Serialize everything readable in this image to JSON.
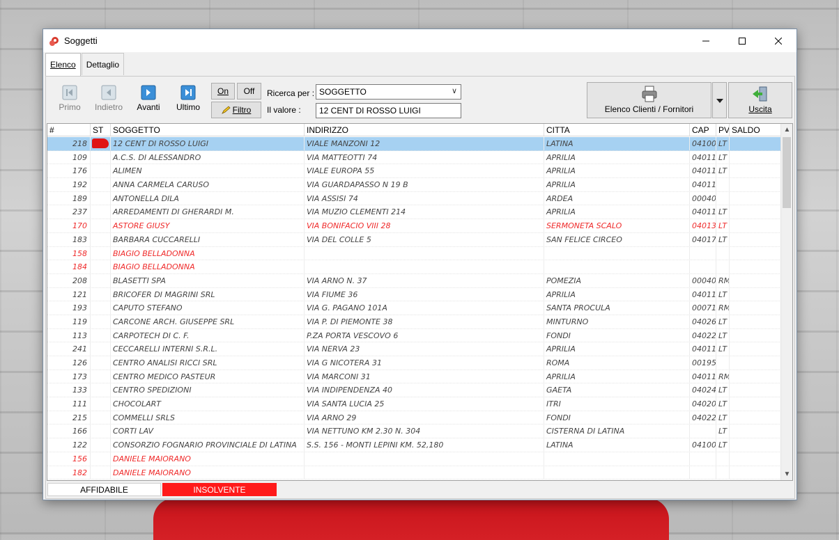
{
  "window": {
    "title": "Soggetti"
  },
  "tabs": [
    {
      "label": "Elenco"
    },
    {
      "label": "Dettaglio"
    }
  ],
  "toolbar": {
    "first_label": "Primo",
    "back_label": "Indietro",
    "forward_label": "Avanti",
    "last_label": "Ultimo",
    "on_label": "On",
    "off_label": "Off",
    "filter_label": "Filtro",
    "search_by_label": "Ricerca per :",
    "search_by_value": "SOGGETTO",
    "value_label": "Il valore :",
    "value": "12 CENT DI ROSSO LUIGI",
    "report_label": "Elenco Clienti / Fornitori",
    "exit_label": "Uscita"
  },
  "grid": {
    "columns": [
      "#",
      "ST",
      "SOGGETTO",
      "INDIRIZZO",
      "CITTA",
      "CAP",
      "PV",
      "SALDO"
    ],
    "rows": [
      {
        "num": "218",
        "soggetto": "12 CENT DI ROSSO LUIGI",
        "indirizzo": "VIALE MANZONI 12",
        "citta": "LATINA",
        "cap": "04100",
        "pv": "LT",
        "saldo": "",
        "status": "insolvente",
        "selected": true
      },
      {
        "num": "109",
        "soggetto": "A.C.S. DI ALESSANDRO",
        "indirizzo": "VIA MATTEOTTI 74",
        "citta": "APRILIA",
        "cap": "04011",
        "pv": "LT",
        "saldo": ""
      },
      {
        "num": "176",
        "soggetto": "ALIMEN",
        "indirizzo": "VIALE EUROPA 55",
        "citta": "APRILIA",
        "cap": "04011",
        "pv": "LT",
        "saldo": ""
      },
      {
        "num": "192",
        "soggetto": "ANNA CARMELA CARUSO",
        "indirizzo": "VIA GUARDAPASSO N 19 B",
        "citta": "APRILIA",
        "cap": "04011",
        "pv": "",
        "saldo": ""
      },
      {
        "num": "189",
        "soggetto": "ANTONELLA DILA",
        "indirizzo": "VIA ASSISI 74",
        "citta": "ARDEA",
        "cap": "00040",
        "pv": "",
        "saldo": ""
      },
      {
        "num": "237",
        "soggetto": "ARREDAMENTI DI GHERARDI M.",
        "indirizzo": "VIA MUZIO CLEMENTI 214",
        "citta": "APRILIA",
        "cap": "04011",
        "pv": "LT",
        "saldo": ""
      },
      {
        "num": "170",
        "soggetto": "ASTORE GIUSY",
        "indirizzo": "VIA BONIFACIO VIII 28",
        "citta": "SERMONETA SCALO",
        "cap": "04013",
        "pv": "LT",
        "saldo": "",
        "red": true
      },
      {
        "num": "183",
        "soggetto": "BARBARA CUCCARELLI",
        "indirizzo": "VIA DEL COLLE 5",
        "citta": "SAN FELICE CIRCEO",
        "cap": "04017",
        "pv": "LT",
        "saldo": ""
      },
      {
        "num": "158",
        "soggetto": "BIAGIO BELLADONNA",
        "indirizzo": "",
        "citta": "",
        "cap": "",
        "pv": "",
        "saldo": "",
        "red": true
      },
      {
        "num": "184",
        "soggetto": "BIAGIO BELLADONNA",
        "indirizzo": "",
        "citta": "",
        "cap": "",
        "pv": "",
        "saldo": "",
        "red": true
      },
      {
        "num": "208",
        "soggetto": "BLASETTI SPA",
        "indirizzo": "VIA ARNO N. 37",
        "citta": "POMEZIA",
        "cap": "00040",
        "pv": "RM",
        "saldo": ""
      },
      {
        "num": "121",
        "soggetto": "BRICOFER DI MAGRINI SRL",
        "indirizzo": "VIA FIUME 36",
        "citta": "APRILIA",
        "cap": "04011",
        "pv": "LT",
        "saldo": ""
      },
      {
        "num": "193",
        "soggetto": "CAPUTO STEFANO",
        "indirizzo": "VIA G. PAGANO 101A",
        "citta": "SANTA PROCULA",
        "cap": "00071",
        "pv": "RM",
        "saldo": ""
      },
      {
        "num": "119",
        "soggetto": "CARCONE ARCH. GIUSEPPE SRL",
        "indirizzo": "VIA P. DI PIEMONTE 38",
        "citta": "MINTURNO",
        "cap": "04026",
        "pv": "LT",
        "saldo": ""
      },
      {
        "num": "113",
        "soggetto": "CARPOTECH DI C. F.",
        "indirizzo": "P.ZA PORTA VESCOVO 6",
        "citta": "FONDI",
        "cap": "04022",
        "pv": "LT",
        "saldo": ""
      },
      {
        "num": "241",
        "soggetto": "CECCARELLI INTERNI S.R.L.",
        "indirizzo": "VIA NERVA 23",
        "citta": "APRILIA",
        "cap": "04011",
        "pv": "LT",
        "saldo": ""
      },
      {
        "num": "126",
        "soggetto": "CENTRO ANALISI RICCI SRL",
        "indirizzo": "VIA G NICOTERA 31",
        "citta": "ROMA",
        "cap": "00195",
        "pv": "",
        "saldo": ""
      },
      {
        "num": "173",
        "soggetto": "CENTRO MEDICO PASTEUR",
        "indirizzo": "VIA MARCONI 31",
        "citta": "APRILIA",
        "cap": "04011",
        "pv": "RM",
        "saldo": ""
      },
      {
        "num": "133",
        "soggetto": "CENTRO SPEDIZIONI",
        "indirizzo": "VIA INDIPENDENZA 40",
        "citta": "GAETA",
        "cap": "04024",
        "pv": "LT",
        "saldo": ""
      },
      {
        "num": "111",
        "soggetto": "CHOCOLART",
        "indirizzo": "VIA SANTA LUCIA 25",
        "citta": "ITRI",
        "cap": "04020",
        "pv": "LT",
        "saldo": ""
      },
      {
        "num": "215",
        "soggetto": "COMMELLI SRLS",
        "indirizzo": "VIA ARNO 29",
        "citta": "FONDI",
        "cap": "04022",
        "pv": "LT",
        "saldo": ""
      },
      {
        "num": "166",
        "soggetto": "CORTI LAV",
        "indirizzo": "VIA NETTUNO KM 2.30 N. 304",
        "citta": "CISTERNA DI LATINA",
        "cap": "",
        "pv": "LT",
        "saldo": ""
      },
      {
        "num": "122",
        "soggetto": "CONSORZIO FOGNARIO PROVINCIALE DI LATINA",
        "indirizzo": "S.S. 156 - MONTI LEPINI KM. 52,180",
        "citta": "LATINA",
        "cap": "04100",
        "pv": "LT",
        "saldo": ""
      },
      {
        "num": "156",
        "soggetto": "DANIELE MAIORANO",
        "indirizzo": "",
        "citta": "",
        "cap": "",
        "pv": "",
        "saldo": "",
        "red": true
      },
      {
        "num": "182",
        "soggetto": "DANIELE MAIORANO",
        "indirizzo": "",
        "citta": "",
        "cap": "",
        "pv": "",
        "saldo": "",
        "red": true
      }
    ]
  },
  "legend": [
    {
      "label": "AFFIDABILE",
      "color": "#ffffff"
    },
    {
      "label": "INSOLVENTE",
      "color": "#ff1a1a"
    }
  ],
  "colors": {
    "selection": "#a6d1f2",
    "insolvente": "#e01515",
    "red_text": "#ef2a2a"
  }
}
